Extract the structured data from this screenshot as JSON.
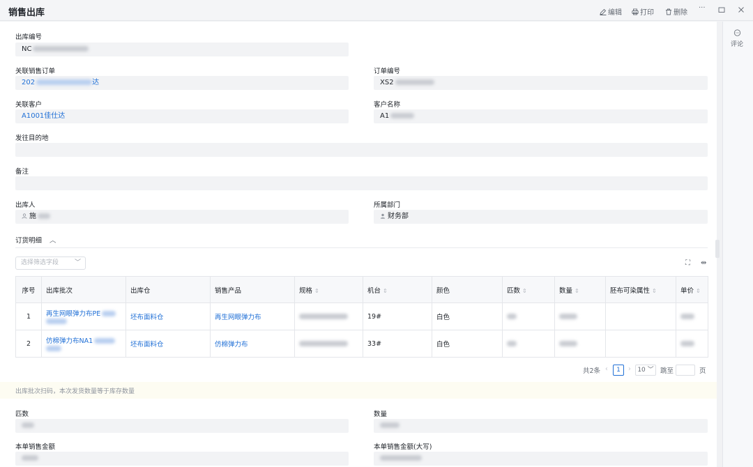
{
  "header": {
    "title": "销售出库",
    "edit": "编辑",
    "print": "打印",
    "delete": "删除",
    "more": "···"
  },
  "rail": {
    "comment": "评论"
  },
  "form": {
    "outbound_no_label": "出库编号",
    "outbound_no_value": "NC",
    "linked_order_label": "关联销售订单",
    "linked_order_value_prefix": "202",
    "linked_order_value_suffix": "达",
    "order_no_label": "订单编号",
    "order_no_value": "XS2",
    "linked_customer_label": "关联客户",
    "linked_customer_value": "A1001佳仕达",
    "customer_name_label": "客户名称",
    "customer_name_value": "A1",
    "destination_label": "发往目的地",
    "remark_label": "备注",
    "operator_label": "出库人",
    "operator_value": "施",
    "dept_label": "所属部门",
    "dept_value": "财务部"
  },
  "detail": {
    "section_title": "订货明细",
    "filter_placeholder": "选择筛选字段",
    "columns": [
      "序号",
      "出库批次",
      "出库仓",
      "销售产品",
      "规格",
      "机台",
      "颜色",
      "匹数",
      "数量",
      "胚布可染属性",
      "单价"
    ],
    "rows": [
      {
        "no": "1",
        "batch": "再生网眼弹力布PE",
        "warehouse": "坯布面料仓",
        "product": "再生网眼弹力布",
        "machine": "19#",
        "color": "白色"
      },
      {
        "no": "2",
        "batch": "仿棉弹力布NA1",
        "warehouse": "坯布面料仓",
        "product": "仿棉弹力布",
        "machine": "33#",
        "color": "白色"
      }
    ],
    "pager": {
      "total": "共2条",
      "current": "1",
      "page_size": "10",
      "goto": "跳至",
      "page_unit": "页"
    }
  },
  "note": "出库批次扫码，本次发货数量等于库存数量",
  "summary": {
    "pieces_label": "匹数",
    "quantity_label": "数量",
    "amount_label": "本单销售金额",
    "amount_upper_label": "本单销售金额(大写)"
  }
}
